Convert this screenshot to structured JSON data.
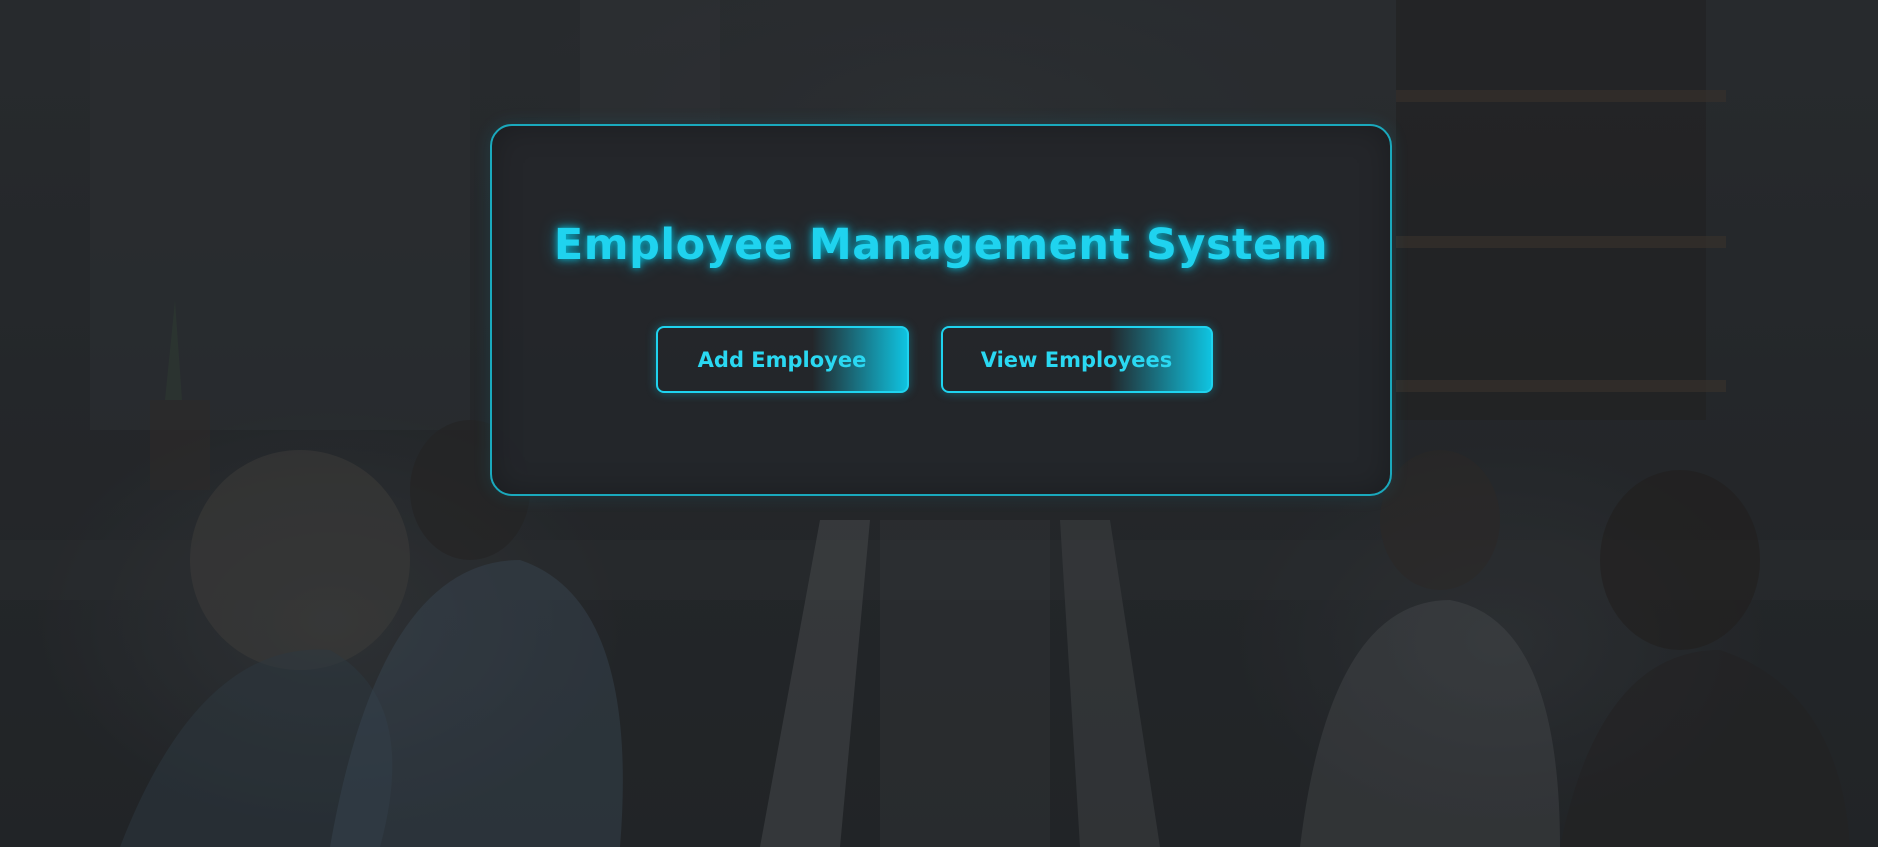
{
  "app": {
    "title": "Employee Management System"
  },
  "actions": {
    "add_label": "Add Employee",
    "view_label": "View Employees"
  },
  "colors": {
    "accent": "#1fd3ef",
    "card_border": "#1aa9bd",
    "card_background": "#24262a"
  }
}
